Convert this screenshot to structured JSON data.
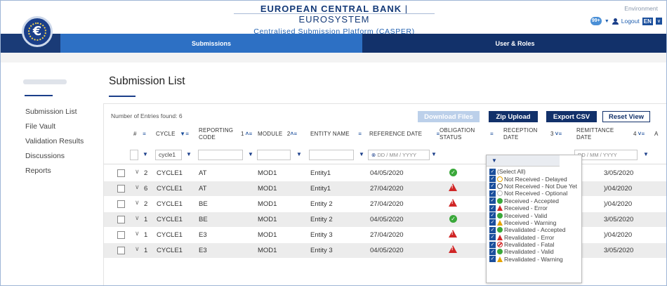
{
  "header": {
    "title": "EUROPEAN CENTRAL BANK",
    "separator": "|",
    "system": "EUROSYSTEM",
    "subtitle": "Centralised Submission Platform (CASPER)",
    "environment_label": "Environment",
    "notification_count": "99+",
    "logout_label": "Logout",
    "language": "EN"
  },
  "nav": {
    "tabs": [
      {
        "label": "Submissions",
        "active": true
      },
      {
        "label": "User & Roles",
        "active": false
      }
    ]
  },
  "sidebar": {
    "items": [
      {
        "label": "Submission List"
      },
      {
        "label": "File Vault"
      },
      {
        "label": "Validation Results"
      },
      {
        "label": "Discussions"
      },
      {
        "label": "Reports"
      }
    ]
  },
  "main": {
    "title": "Submission List",
    "entries_found": "Number of Entries found: 6",
    "buttons": {
      "download": "Download Files",
      "zip": "Zip Upload",
      "csv": "Export CSV",
      "reset": "Reset View"
    },
    "columns": {
      "index": "#",
      "cycle": "CYCLE",
      "reporting_code_1": "REPORTING",
      "reporting_code_2": "CODE",
      "reporting_code_sort": "1",
      "module": "MODULE",
      "module_sort": "2",
      "entity": "ENTITY NAME",
      "reference_date": "REFERENCE DATE",
      "obligation_1": "OBLIGATION",
      "obligation_2": "STATUS",
      "reception_1": "RECEPTION",
      "reception_2": "DATE",
      "reception_sort": "3",
      "remittance_1": "REMITTANCE",
      "remittance_2": "DATE",
      "remittance_sort": "4",
      "cut_off": "A"
    },
    "filters": {
      "cycle": "cycle1",
      "date_placeholder": "DD / MM / YYYY"
    },
    "rows": [
      {
        "count": "2",
        "cycle": "CYCLE1",
        "code": "AT",
        "module": "MOD1",
        "entity": "Entity1",
        "ref_date": "04/05/2020",
        "status": "accepted",
        "remittance": "3/05/2020"
      },
      {
        "count": "6",
        "cycle": "CYCLE1",
        "code": "AT",
        "module": "MOD1",
        "entity": "Entity1",
        "ref_date": "27/04/2020",
        "status": "error",
        "remittance": ")/04/2020"
      },
      {
        "count": "2",
        "cycle": "CYCLE1",
        "code": "BE",
        "module": "MOD1",
        "entity": "Entity 2",
        "ref_date": "27/04/2020",
        "status": "error",
        "remittance": ")/04/2020"
      },
      {
        "count": "1",
        "cycle": "CYCLE1",
        "code": "BE",
        "module": "MOD1",
        "entity": "Entity 2",
        "ref_date": "04/05/2020",
        "status": "accepted",
        "remittance": "3/05/2020"
      },
      {
        "count": "1",
        "cycle": "CYCLE1",
        "code": "E3",
        "module": "MOD1",
        "entity": "Entity 3",
        "ref_date": "27/04/2020",
        "status": "error",
        "remittance": ")/04/2020"
      },
      {
        "count": "1",
        "cycle": "CYCLE1",
        "code": "E3",
        "module": "MOD1",
        "entity": "Entity 3",
        "ref_date": "04/05/2020",
        "status": "error",
        "remittance": "3/05/2020"
      }
    ]
  },
  "dropdown": {
    "options": [
      {
        "label": "(Select All)",
        "icon": "none",
        "checked": true
      },
      {
        "label": "Not Received - Delayed",
        "icon": "delayed",
        "checked": true
      },
      {
        "label": "Not Received - Not Due Yet",
        "icon": "notdue",
        "checked": true
      },
      {
        "label": "Not Received - Optional",
        "icon": "optional",
        "checked": true
      },
      {
        "label": "Received - Accepted",
        "icon": "accepted",
        "checked": true
      },
      {
        "label": "Received - Error",
        "icon": "error",
        "checked": true
      },
      {
        "label": "Received - Valid",
        "icon": "accepted",
        "checked": true
      },
      {
        "label": "Received - Warning",
        "icon": "warning",
        "checked": true
      },
      {
        "label": "Revalidated - Accepted",
        "icon": "accepted",
        "checked": true
      },
      {
        "label": "Revalidated - Error",
        "icon": "error",
        "checked": true
      },
      {
        "label": "Revalidated - Fatal",
        "icon": "fatal",
        "checked": true
      },
      {
        "label": "Revalidated - Valid",
        "icon": "accepted",
        "checked": true
      },
      {
        "label": "Revalidated - Warning",
        "icon": "warning",
        "checked": true
      }
    ]
  },
  "colors": {
    "brand_navy": "#12316a",
    "tab_blue": "#2d70c4",
    "ok_green": "#3aa83a",
    "error_red": "#d02626",
    "warning_orange": "#e6a300"
  }
}
